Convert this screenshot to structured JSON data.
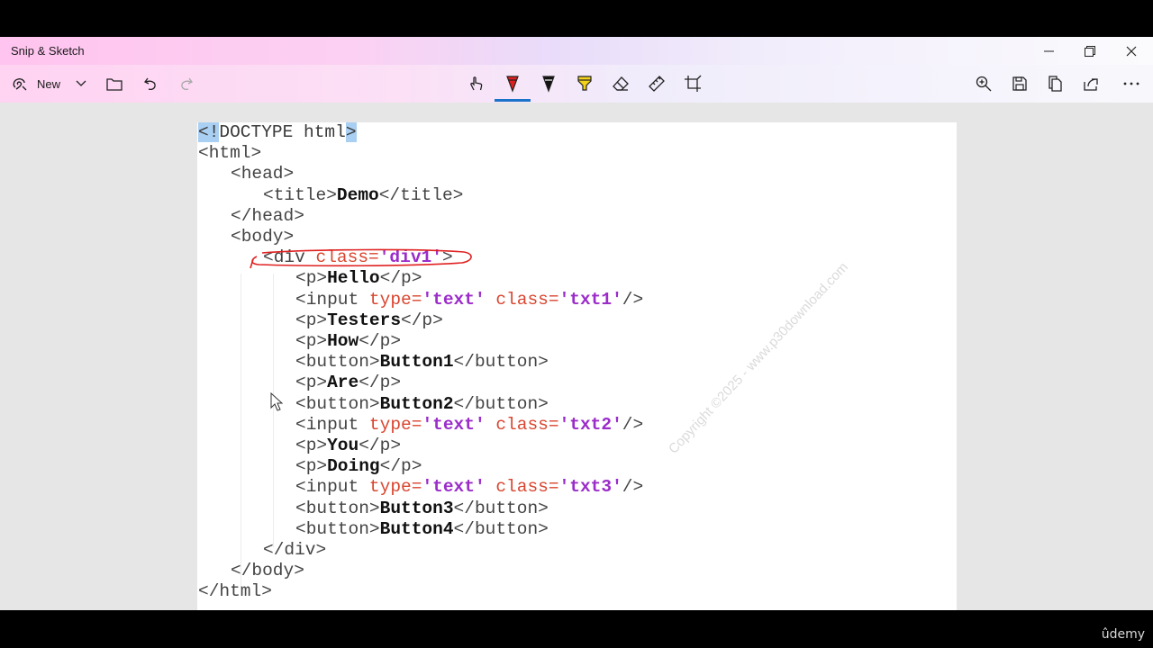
{
  "window": {
    "title": "Snip & Sketch"
  },
  "toolbar": {
    "new_label": "New",
    "left_icons": [
      "new-snip-icon",
      "chevron-down-icon",
      "folder-icon",
      "undo-icon",
      "redo-icon"
    ],
    "center_tools": [
      "touch-writing-icon",
      "ballpoint-pen-icon",
      "pencil-icon",
      "highlighter-icon",
      "eraser-icon",
      "ruler-icon",
      "crop-icon"
    ],
    "right_icons": [
      "zoom-icon",
      "save-icon",
      "copy-icon",
      "share-icon",
      "more-icon"
    ],
    "active_tool": "ballpoint-pen"
  },
  "code": {
    "lines": [
      [
        "<!",
        "DOCTYPE html",
        ">"
      ],
      [
        "<html>"
      ],
      [
        "<head>"
      ],
      [
        "<title>",
        "Demo",
        "</title>"
      ],
      [
        "</head>"
      ],
      [
        "<body>"
      ],
      [
        "<div ",
        "class=",
        "'div1'",
        ">"
      ],
      [
        "<p>",
        "Hello",
        "</p>"
      ],
      [
        "<input ",
        "type=",
        "'text'",
        " ",
        "class=",
        "'txt1'",
        "/>"
      ],
      [
        "<p>",
        "Testers",
        "</p>"
      ],
      [
        "<p>",
        "How",
        "</p>"
      ],
      [
        "<button>",
        "Button1",
        "</button>"
      ],
      [
        "<p>",
        "Are",
        "</p>"
      ],
      [
        "<button>",
        "Button2",
        "</button>"
      ],
      [
        "<input ",
        "type=",
        "'text'",
        " ",
        "class=",
        "'txt2'",
        "/>"
      ],
      [
        "<p>",
        "You",
        "</p>"
      ],
      [
        "<p>",
        "Doing",
        "</p>"
      ],
      [
        "<input ",
        "type=",
        "'text'",
        " ",
        "class=",
        "'txt3'",
        "/>"
      ],
      [
        "<button>",
        "Button3",
        "</button>"
      ],
      [
        "<button>",
        "Button4",
        "</button>"
      ],
      [
        "</div>"
      ],
      [
        "</body>"
      ],
      [
        "</html>"
      ]
    ]
  },
  "watermark": "Copyright ©2025 - www.p30download.com",
  "branding": {
    "udemy": "ûdemy"
  },
  "colors": {
    "accent": "#1a73c8",
    "attr": "#d9452f",
    "string": "#9b2cc9",
    "pen_annotation": "#e02020"
  }
}
